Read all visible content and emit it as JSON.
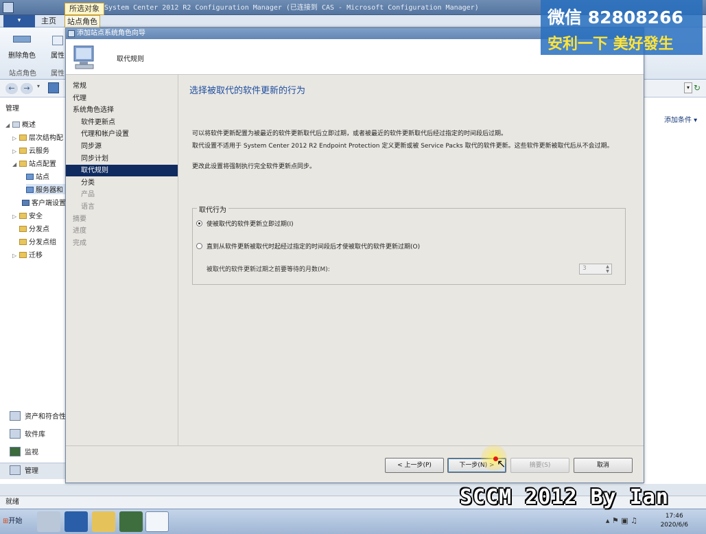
{
  "window": {
    "context_tab_group": "所选对象",
    "title": "System Center 2012 R2 Configuration Manager (已连接到 CAS - Microsoft Configuration Manager)"
  },
  "ribbon": {
    "file_tab": "▾",
    "tabs": [
      "主页",
      "站点角色"
    ],
    "buttons": [
      "删除角色",
      "属性"
    ],
    "group_labels": [
      "站点角色",
      "属性"
    ]
  },
  "navigation": {
    "section_title": "管理",
    "tree": [
      "概述",
      "层次结构配",
      "云服务",
      "站点配置",
      "站点",
      "服务器和",
      "客户端设置",
      "安全",
      "分发点",
      "分发点组",
      "迁移"
    ],
    "workspaces": [
      "资产和符合性",
      "软件库",
      "监视",
      "管理"
    ]
  },
  "right_pane": {
    "add_criteria": "添加条件"
  },
  "status_bar": {
    "text": "就绪"
  },
  "taskbar": {
    "start": "开始",
    "time": "17:46",
    "date": "2020/6/6"
  },
  "wizard": {
    "title": "添加站点系统角色向导",
    "header_title": "取代规则",
    "steps": [
      {
        "label": "常规",
        "level": 0,
        "state": "normal"
      },
      {
        "label": "代理",
        "level": 0,
        "state": "normal"
      },
      {
        "label": "系统角色选择",
        "level": 0,
        "state": "normal"
      },
      {
        "label": "软件更新点",
        "level": 1,
        "state": "normal"
      },
      {
        "label": "代理和帐户设置",
        "level": 1,
        "state": "normal"
      },
      {
        "label": "同步源",
        "level": 1,
        "state": "normal"
      },
      {
        "label": "同步计划",
        "level": 1,
        "state": "normal"
      },
      {
        "label": "取代规则",
        "level": 1,
        "state": "active"
      },
      {
        "label": "分类",
        "level": 1,
        "state": "normal"
      },
      {
        "label": "产品",
        "level": 1,
        "state": "disabled"
      },
      {
        "label": "语言",
        "level": 1,
        "state": "disabled"
      },
      {
        "label": "摘要",
        "level": 0,
        "state": "disabled"
      },
      {
        "label": "进度",
        "level": 0,
        "state": "disabled"
      },
      {
        "label": "完成",
        "level": 0,
        "state": "disabled"
      }
    ],
    "page_heading": "选择被取代的软件更新的行为",
    "paragraphs": [
      "可以将软件更新配置为被最近的软件更新取代后立即过期，或者被最近的软件更新取代后经过指定的时间段后过期。",
      "取代设置不适用于 System Center 2012 R2 Endpoint Protection 定义更新或被 Service Packs 取代的软件更新。这些软件更新被取代后从不会过期。",
      "更改此设置将强制执行完全软件更新点同步。"
    ],
    "group_label": "取代行为",
    "options": [
      {
        "label": "使被取代的软件更新立即过期(I)",
        "selected": true
      },
      {
        "label": "直到从软件更新被取代时起经过指定的时间段后才使被取代的软件更新过期(O)",
        "selected": false
      }
    ],
    "months_label": "被取代的软件更新过期之前要等待的月数(M):",
    "months_value": "3",
    "buttons": {
      "prev": "< 上一步(P)",
      "next": "下一步(N) >",
      "summary": "摘要(S)",
      "cancel": "取消"
    }
  },
  "overlays": {
    "wechat_line1": "微信 82808266",
    "wechat_line2": "安利一下 美好發生",
    "caption": "SCCM 2012 By Ian"
  }
}
